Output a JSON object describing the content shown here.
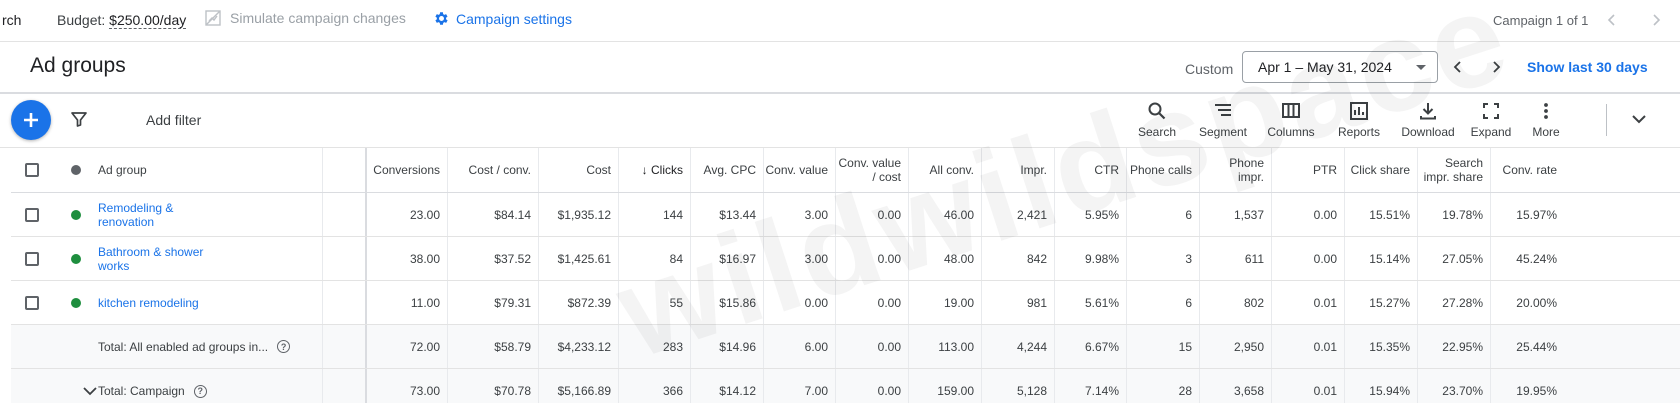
{
  "topbar": {
    "crumb": "rch",
    "budget_label": "Budget:",
    "budget_value": "$250.00/day",
    "simulate": "Simulate campaign changes",
    "settings": "Campaign settings",
    "campaign_count": "Campaign 1 of 1"
  },
  "header": {
    "title": "Ad groups",
    "custom_label": "Custom",
    "date_range": "Apr 1 – May 31, 2024",
    "show_last": "Show last 30 days"
  },
  "toolbar": {
    "add_filter": "Add filter",
    "tools": [
      {
        "label": "Search",
        "icon": "search-icon"
      },
      {
        "label": "Segment",
        "icon": "segment-icon"
      },
      {
        "label": "Columns",
        "icon": "columns-icon"
      },
      {
        "label": "Reports",
        "icon": "reports-icon"
      },
      {
        "label": "Download",
        "icon": "download-icon"
      },
      {
        "label": "Expand",
        "icon": "expand-icon"
      },
      {
        "label": "More",
        "icon": "more-vert-icon"
      }
    ]
  },
  "table": {
    "name_header": "Ad group",
    "columns": [
      "Conversions",
      "Cost / conv.",
      "Cost",
      "↓ Clicks",
      "Avg. CPC",
      "Conv. value",
      "Conv. value / cost",
      "All conv.",
      "Impr.",
      "CTR",
      "Phone calls",
      "Phone impr.",
      "PTR",
      "Click share",
      "Search impr. share",
      "Conv. rate"
    ],
    "rows": [
      {
        "name": "Remodeling & renovation",
        "status_color": "#1e8e3e",
        "values": [
          "23.00",
          "$84.14",
          "$1,935.12",
          "144",
          "$13.44",
          "3.00",
          "0.00",
          "46.00",
          "2,421",
          "5.95%",
          "6",
          "1,537",
          "0.00",
          "15.51%",
          "19.78%",
          "15.97%"
        ]
      },
      {
        "name": "Bathroom & shower works",
        "status_color": "#1e8e3e",
        "values": [
          "38.00",
          "$37.52",
          "$1,425.61",
          "84",
          "$16.97",
          "3.00",
          "0.00",
          "48.00",
          "842",
          "9.98%",
          "3",
          "611",
          "0.00",
          "15.14%",
          "27.05%",
          "45.24%"
        ]
      },
      {
        "name": "kitchen remodeling",
        "status_color": "#1e8e3e",
        "values": [
          "11.00",
          "$79.31",
          "$872.39",
          "55",
          "$15.86",
          "0.00",
          "0.00",
          "19.00",
          "981",
          "5.61%",
          "6",
          "802",
          "0.01",
          "15.27%",
          "27.28%",
          "20.00%"
        ]
      }
    ],
    "totals": [
      {
        "label": "Total: All enabled ad groups in...",
        "values": [
          "72.00",
          "$58.79",
          "$4,233.12",
          "283",
          "$14.96",
          "6.00",
          "0.00",
          "113.00",
          "4,244",
          "6.67%",
          "15",
          "2,950",
          "0.01",
          "15.35%",
          "22.95%",
          "25.44%"
        ]
      },
      {
        "label": "Total: Campaign",
        "values": [
          "73.00",
          "$70.78",
          "$5,166.89",
          "366",
          "$14.12",
          "7.00",
          "0.00",
          "159.00",
          "5,128",
          "7.14%",
          "28",
          "3,658",
          "0.01",
          "15.94%",
          "23.70%",
          "19.95%"
        ]
      }
    ]
  },
  "watermark": "wildwildspace",
  "colors": {
    "accent": "#1a73e8",
    "enabled": "#1e8e3e",
    "header_dot": "#5f6368"
  }
}
